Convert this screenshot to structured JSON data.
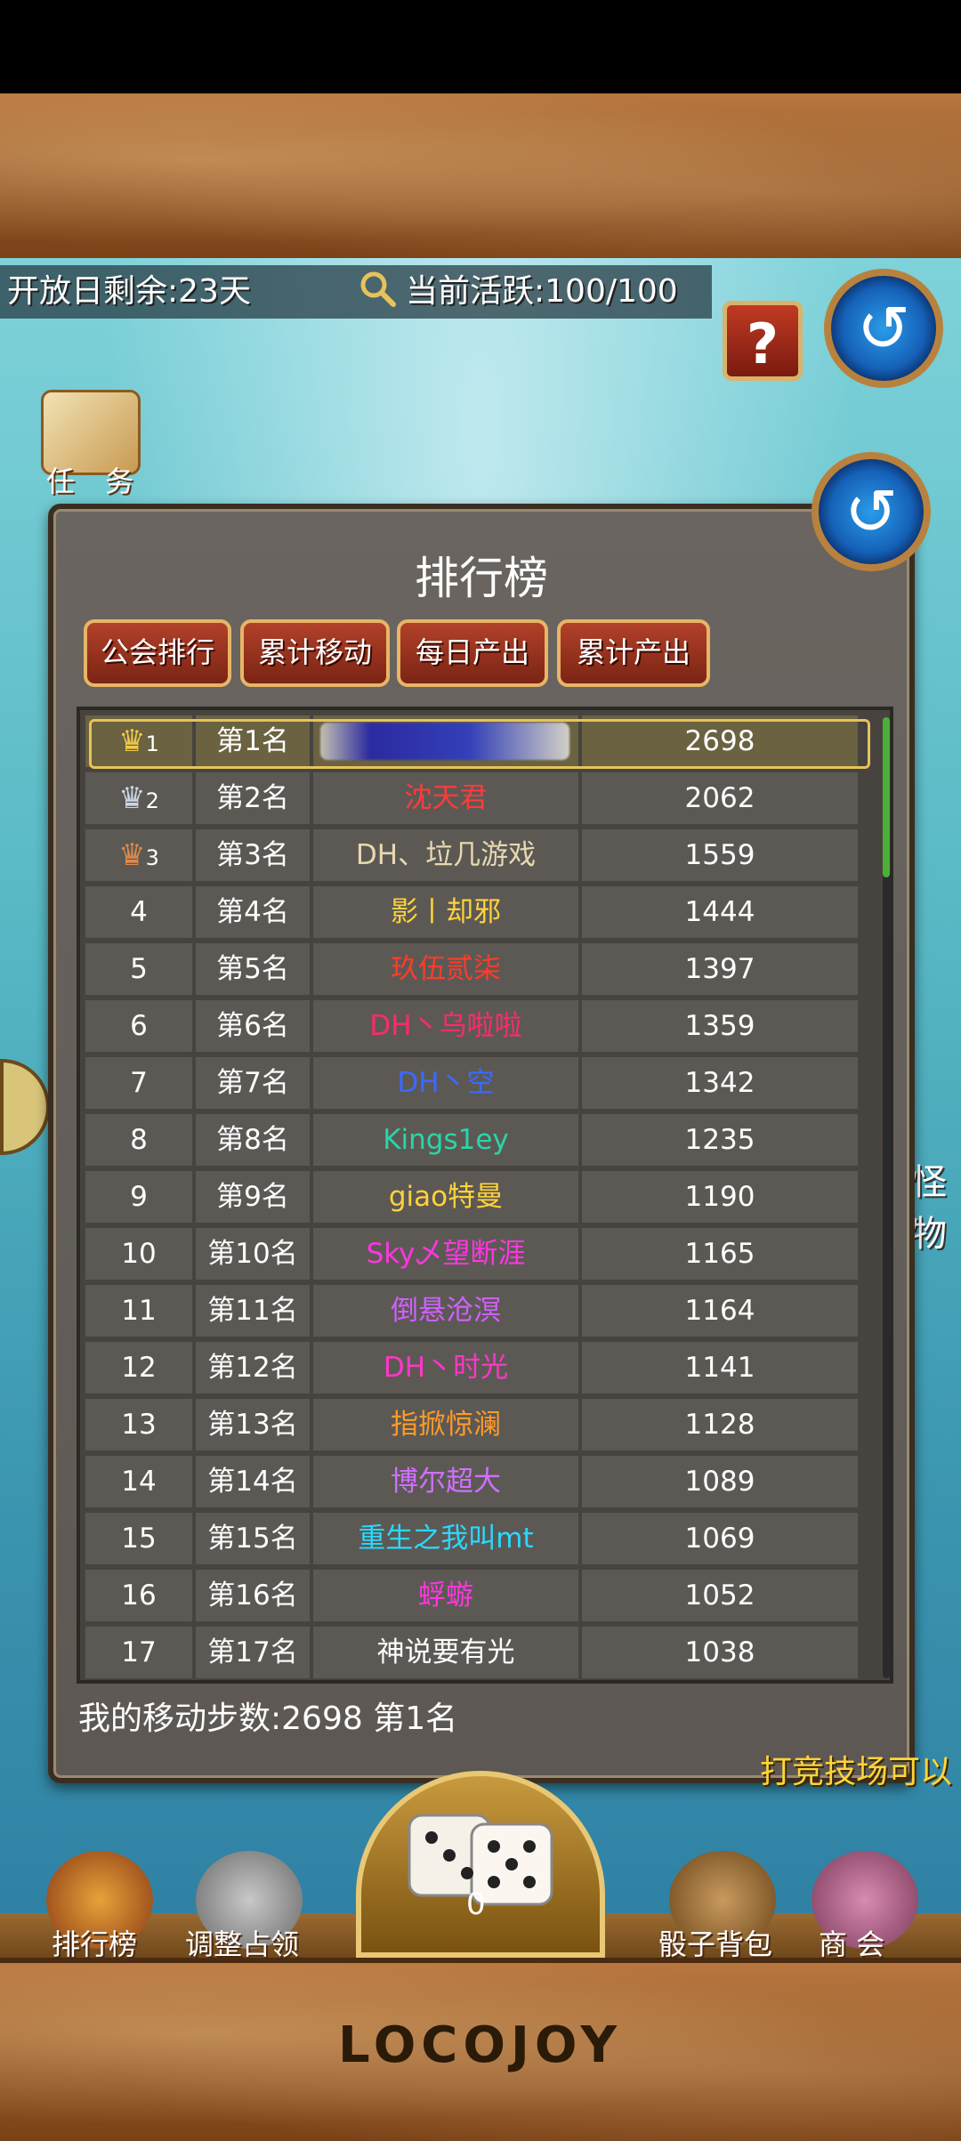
{
  "header": {
    "remaining_days": "开放日剩余:23天",
    "activity": "当前活跃:100/100",
    "help_label": "?"
  },
  "side": {
    "task_label": "任 务",
    "monster_label": "怪物",
    "promo_text": "打竞技场可以"
  },
  "panel": {
    "title": "排行榜",
    "tabs": [
      "公会排行",
      "累计移动",
      "每日产出",
      "累计产出"
    ],
    "rows": [
      {
        "rank": "1",
        "place": "第1名",
        "name": "",
        "score": "2698",
        "name_color": "#ffffff"
      },
      {
        "rank": "2",
        "place": "第2名",
        "name": "沈天君",
        "score": "2062",
        "name_color": "#ff3b3b"
      },
      {
        "rank": "3",
        "place": "第3名",
        "name": "DH、垃几游戏",
        "score": "1559",
        "name_color": "#e8d8b0"
      },
      {
        "rank": "4",
        "place": "第4名",
        "name": "影丨却邪",
        "score": "1444",
        "name_color": "#ffd23a"
      },
      {
        "rank": "5",
        "place": "第5名",
        "name": "玖伍贰柒",
        "score": "1397",
        "name_color": "#ff3b2a"
      },
      {
        "rank": "6",
        "place": "第6名",
        "name": "DH丶乌啦啦",
        "score": "1359",
        "name_color": "#ff2a6a"
      },
      {
        "rank": "7",
        "place": "第7名",
        "name": "DH丶空",
        "score": "1342",
        "name_color": "#3a6aff"
      },
      {
        "rank": "8",
        "place": "第8名",
        "name": "Kings1ey",
        "score": "1235",
        "name_color": "#29d6a8"
      },
      {
        "rank": "9",
        "place": "第9名",
        "name": "giao特曼",
        "score": "1190",
        "name_color": "#ffd23a"
      },
      {
        "rank": "10",
        "place": "第10名",
        "name": "Sky乄望断涯",
        "score": "1165",
        "name_color": "#ff36e0"
      },
      {
        "rank": "11",
        "place": "第11名",
        "name": "倒悬沧溟",
        "score": "1164",
        "name_color": "#d060ff"
      },
      {
        "rank": "12",
        "place": "第12名",
        "name": "DH丶时光",
        "score": "1141",
        "name_color": "#ff36c8"
      },
      {
        "rank": "13",
        "place": "第13名",
        "name": "指掀惊澜",
        "score": "1128",
        "name_color": "#ff9a2a"
      },
      {
        "rank": "14",
        "place": "第14名",
        "name": "博尔超大",
        "score": "1089",
        "name_color": "#d070ff"
      },
      {
        "rank": "15",
        "place": "第15名",
        "name": "重生之我叫mt",
        "score": "1069",
        "name_color": "#2ad8ff"
      },
      {
        "rank": "16",
        "place": "第16名",
        "name": "蜉蝣",
        "score": "1052",
        "name_color": "#ff36e0"
      },
      {
        "rank": "17",
        "place": "第17名",
        "name": "神说要有光",
        "score": "1038",
        "name_color": "#ffffff"
      }
    ],
    "my_steps": "我的移动步数:2698   第1名"
  },
  "bottom_nav": {
    "ranking": "排行榜",
    "adjust": "调整占领",
    "dice_count": "0",
    "dice_bag": "骰子背包",
    "guild_shop": "商 会"
  },
  "logo": "LOCOJOY"
}
